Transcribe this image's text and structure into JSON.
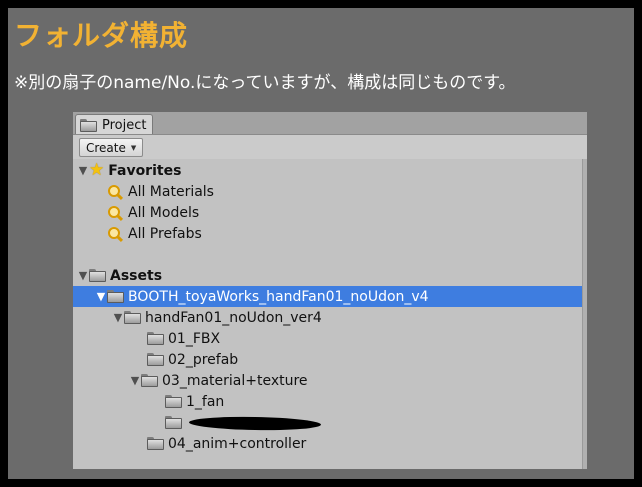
{
  "slide": {
    "title": "フォルダ構成",
    "subtitle": "※別の扇子のname/No.になっていますが、構成は同じものです。"
  },
  "window": {
    "tab_label": "Project",
    "create_label": "Create",
    "tree": [
      {
        "label": "Favorites",
        "icon": "star-icon",
        "expanded": true,
        "bold": true
      },
      {
        "label": "All Materials",
        "icon": "search-icon"
      },
      {
        "label": "All Models",
        "icon": "search-icon"
      },
      {
        "label": "All Prefabs",
        "icon": "search-icon"
      },
      {
        "label": "Assets",
        "icon": "folder-icon",
        "expanded": true,
        "bold": true
      },
      {
        "label": "BOOTH_toyaWorks_handFan01_noUdon_v4",
        "icon": "folder-icon",
        "expanded": true,
        "selected": true
      },
      {
        "label": "handFan01_noUdon_ver4",
        "icon": "folder-icon",
        "expanded": true
      },
      {
        "label": "01_FBX",
        "icon": "folder-icon"
      },
      {
        "label": "02_prefab",
        "icon": "folder-icon"
      },
      {
        "label": "03_material+texture",
        "icon": "folder-icon",
        "expanded": true
      },
      {
        "label": "1_fan",
        "icon": "folder-icon"
      },
      {
        "label": "",
        "icon": "folder-icon",
        "redacted": true
      },
      {
        "label": "04_anim+controller",
        "icon": "folder-icon"
      }
    ]
  },
  "colors": {
    "title": "#f2b233",
    "selection": "#3e7de0"
  }
}
